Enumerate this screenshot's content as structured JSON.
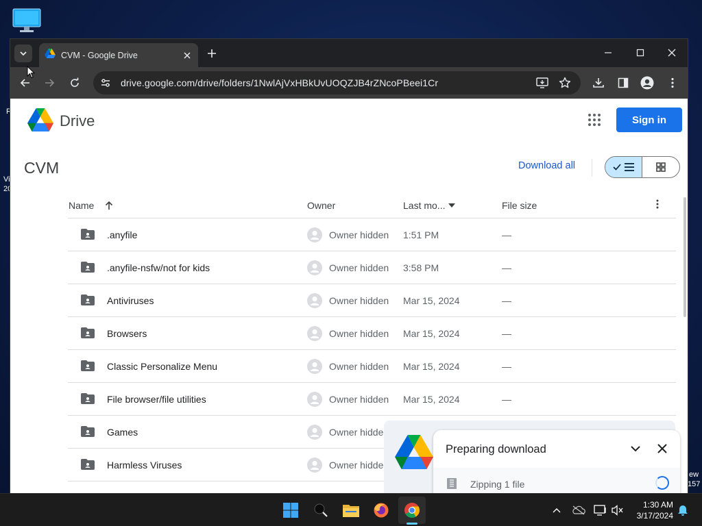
{
  "desktop": {
    "frag_r": "R",
    "frag_vi": "Vi",
    "frag_20": "20",
    "frag_ew": "ew",
    "frag_157": "157"
  },
  "browser": {
    "tab": {
      "title": "CVM - Google Drive"
    },
    "url": "drive.google.com/drive/folders/1NwlAjVxHBkUvUOQZJB4rZNcoPBeei1Cr"
  },
  "drive": {
    "app_name": "Drive",
    "sign_in": "Sign in",
    "folder_title": "CVM",
    "download_all": "Download all",
    "columns": {
      "name": "Name",
      "owner": "Owner",
      "modified": "Last mo...",
      "size": "File size"
    },
    "rows": [
      {
        "name": ".anyfile",
        "owner": "Owner hidden",
        "modified": "1:51 PM",
        "size": "—"
      },
      {
        "name": ".anyfile-nsfw/not for kids",
        "owner": "Owner hidden",
        "modified": "3:58 PM",
        "size": "—"
      },
      {
        "name": "Antiviruses",
        "owner": "Owner hidden",
        "modified": "Mar 15, 2024",
        "size": "—"
      },
      {
        "name": "Browsers",
        "owner": "Owner hidden",
        "modified": "Mar 15, 2024",
        "size": "—"
      },
      {
        "name": "Classic Personalize Menu",
        "owner": "Owner hidden",
        "modified": "Mar 15, 2024",
        "size": "—"
      },
      {
        "name": "File browser/file utilities",
        "owner": "Owner hidden",
        "modified": "Mar 15, 2024",
        "size": "—"
      },
      {
        "name": "Games",
        "owner": "Owner hidde",
        "modified": "",
        "size": ""
      },
      {
        "name": "Harmless Viruses",
        "owner": "Owner hidde",
        "modified": "",
        "size": ""
      }
    ]
  },
  "download_panel": {
    "title": "Preparing download",
    "status": "Zipping 1 file"
  },
  "taskbar": {
    "time": "1:30 AM",
    "date": "3/17/2024"
  },
  "colors": {
    "accent": "#1a73e8",
    "chrome_dark": "#202124",
    "chrome_toolbar": "#3c3c3c",
    "list_view_selected": "#c2e7ff"
  }
}
